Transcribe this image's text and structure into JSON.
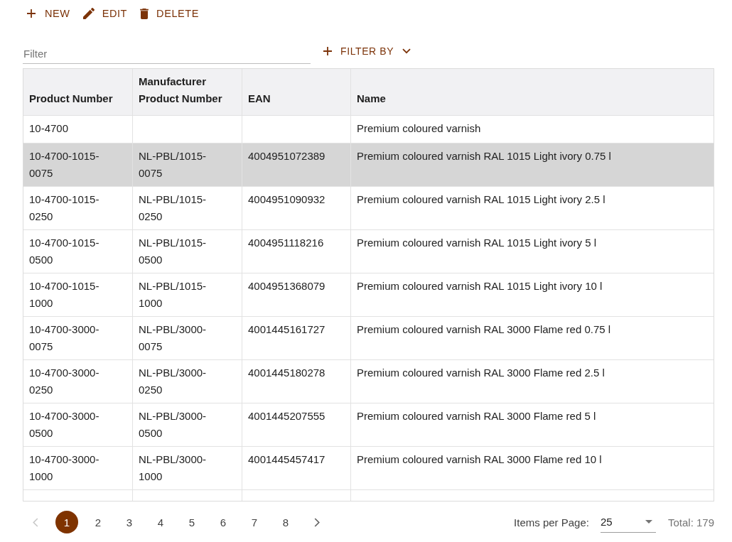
{
  "toolbar": {
    "buttons": [
      {
        "kind": "new",
        "label": "NEW"
      },
      {
        "kind": "edit",
        "label": "EDIT"
      },
      {
        "kind": "delete",
        "label": "DELETE"
      }
    ]
  },
  "filter": {
    "placeholder": "Filter",
    "button": {
      "label": "FILTER BY"
    }
  },
  "table": {
    "columns": [
      "Product Number",
      "Manufacturer Product Number",
      "EAN",
      "Name"
    ],
    "rows": [
      {
        "cells": [
          "10-4700",
          null,
          null,
          "Premium coloured varnish"
        ],
        "selected": false
      },
      {
        "cells": [
          "10-4700-1015-0075",
          "NL-PBL/1015-0075",
          "4004951072389",
          "Premium coloured varnish RAL 1015 Light ivory 0.75 l"
        ],
        "selected": true
      },
      {
        "cells": [
          "10-4700-1015-0250",
          "NL-PBL/1015-0250",
          "4004951090932",
          "Premium coloured varnish RAL 1015 Light ivory 2.5 l"
        ],
        "selected": false
      },
      {
        "cells": [
          "10-4700-1015-0500",
          "NL-PBL/1015-0500",
          "4004951118216",
          "Premium coloured varnish RAL 1015 Light ivory 5 l"
        ],
        "selected": false
      },
      {
        "cells": [
          "10-4700-1015-1000",
          "NL-PBL/1015-1000",
          "4004951368079",
          "Premium coloured varnish RAL 1015 Light ivory 10 l"
        ],
        "selected": false
      },
      {
        "cells": [
          "10-4700-3000-0075",
          "NL-PBL/3000-0075",
          "4001445161727",
          "Premium coloured varnish RAL 3000 Flame red 0.75 l"
        ],
        "selected": false
      },
      {
        "cells": [
          "10-4700-3000-0250",
          "NL-PBL/3000-0250",
          "4001445180278",
          "Premium coloured varnish RAL 3000 Flame red 2.5 l"
        ],
        "selected": false
      },
      {
        "cells": [
          "10-4700-3000-0500",
          "NL-PBL/3000-0500",
          "4001445207555",
          "Premium coloured varnish RAL 3000 Flame red 5 l"
        ],
        "selected": false
      },
      {
        "cells": [
          "10-4700-3000-1000",
          "NL-PBL/3000-1000",
          "4001445457417",
          "Premium coloured varnish RAL 3000 Flame red 10 l"
        ],
        "selected": false
      }
    ]
  },
  "pagination": {
    "previous": {
      "disabled": true
    },
    "pages": [
      {
        "label": "1",
        "selected": true
      },
      {
        "label": "2",
        "selected": false
      },
      {
        "label": "3",
        "selected": false
      },
      {
        "label": "4",
        "selected": false
      },
      {
        "label": "5",
        "selected": false
      },
      {
        "label": "6",
        "selected": false
      },
      {
        "label": "7",
        "selected": false
      },
      {
        "label": "8",
        "selected": false
      }
    ],
    "next": {
      "disabled": false
    },
    "items_per_page_label": "Items per Page:",
    "items_per_page": "25",
    "total": "Total: 179"
  }
}
